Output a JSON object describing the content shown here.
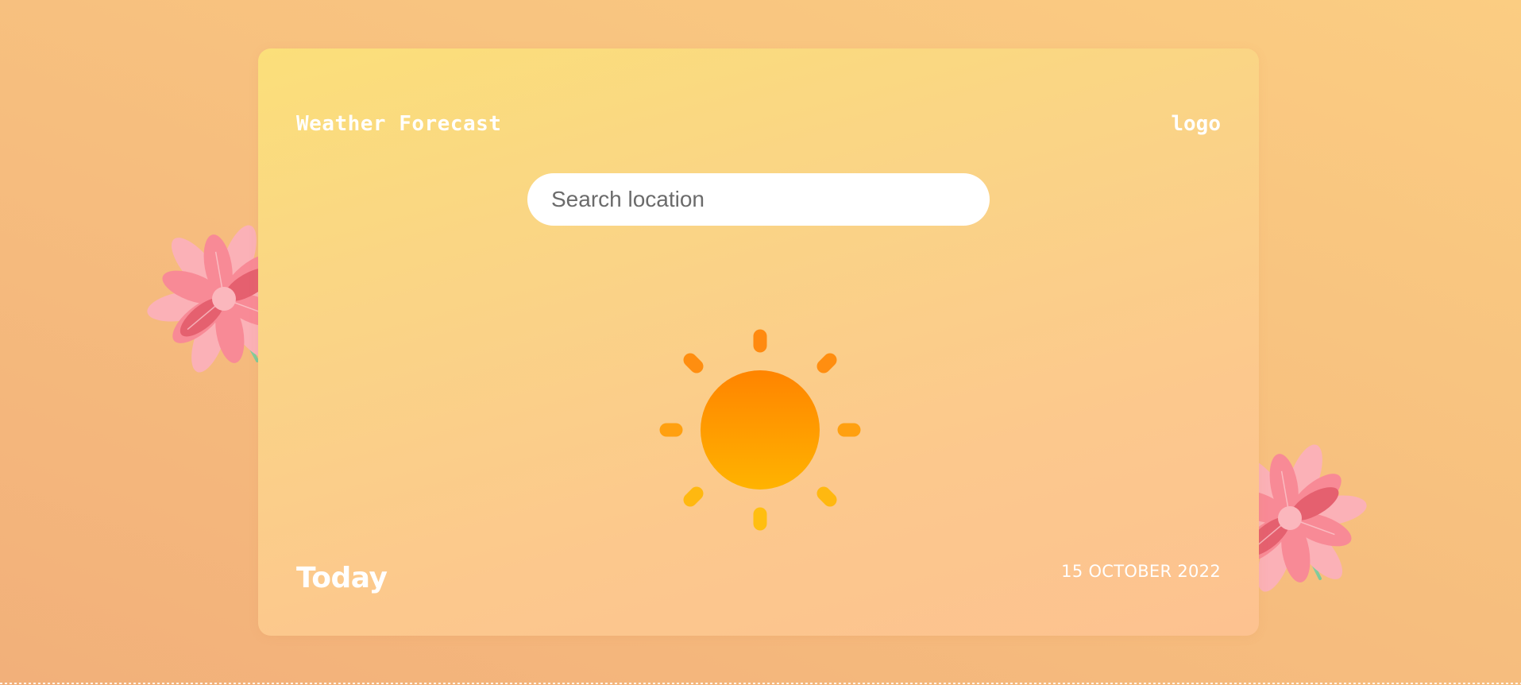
{
  "header": {
    "title": "Weather Forecast",
    "logo": "logo"
  },
  "search": {
    "placeholder": "Search location",
    "value": ""
  },
  "weather": {
    "icon": "sun-icon",
    "day_label": "Today",
    "date": "15 OCTOBER 2022"
  },
  "decorations": {
    "left_icon": "flower-icon",
    "right_icon": "flower-icon"
  },
  "colors": {
    "background_start": "#f2b07a",
    "background_end": "#fbcd82",
    "card_top": "#fbdf7a",
    "card_bottom": "#fdc290",
    "sun_core_top": "#ff8a00",
    "sun_core_bottom": "#ffb300",
    "text": "#ffffff",
    "search_bg": "#ffffff",
    "flower_pink": "#f88a96",
    "flower_dark": "#e5606f"
  }
}
